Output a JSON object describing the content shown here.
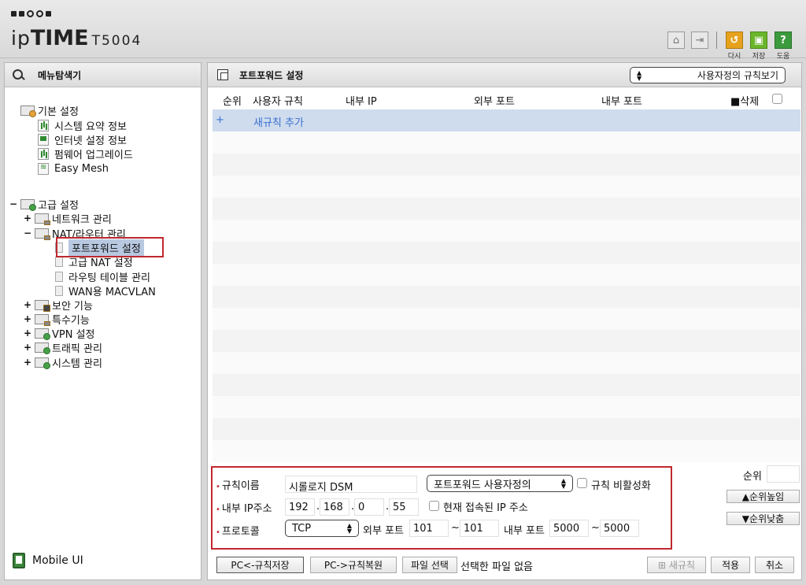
{
  "header": {
    "brand": "ipTIME",
    "brand_prefix": "ip",
    "brand_bold": "TIME",
    "model": "T5004",
    "buttons": [
      {
        "icon": "home-icon"
      },
      {
        "icon": "logout-icon"
      }
    ],
    "actions": [
      {
        "icon": "undo-icon",
        "label": "다시",
        "color": "#e6a21c"
      },
      {
        "icon": "save-icon",
        "label": "저장",
        "color": "#6ab52b"
      },
      {
        "icon": "help-icon",
        "label": "도움",
        "color": "#3b9a3b"
      }
    ]
  },
  "sidebar": {
    "title": "메뉴탐색기",
    "basic": {
      "label": "기본 설정",
      "items": [
        "시스템 요약 정보",
        "인터넷 설정 정보",
        "펌웨어 업그레이드",
        "Easy Mesh"
      ]
    },
    "advanced": {
      "label": "고급 설정",
      "groups": {
        "network": "네트워크 관리",
        "nat": "NAT/라우터 관리",
        "nat_items": [
          "포트포워드 설정",
          "고급 NAT 설정",
          "라우팅 테이블 관리",
          "WAN용 MACVLAN"
        ],
        "security": "보안 기능",
        "special": "특수기능",
        "vpn": "VPN 설정",
        "traffic": "트래픽 관리",
        "system": "시스템 관리"
      }
    },
    "mobile_ui": "Mobile UI"
  },
  "main": {
    "title": "포트포워드 설정",
    "view_select": "사용자정의 규칙보기",
    "columns": {
      "order": "순위",
      "rule": "사용자 규칙",
      "internal_ip": "내부 IP",
      "external_port": "외부 포트",
      "internal_port": "내부 포트",
      "delete": "삭제"
    },
    "add_rule": {
      "plus": "+",
      "label": "새규칙 추가"
    }
  },
  "form": {
    "rule_name_label": "규칙이름",
    "rule_name_value": "시롤로지 DSM",
    "type_select": "포트포워드 사용자정의",
    "disable_label": "규칙 비활성화",
    "ip_label": "내부 IP주소",
    "ip": [
      "192",
      "168",
      "0",
      "55"
    ],
    "current_ip_label": "현재 접속된 IP 주소",
    "protocol_label": "프로토콜",
    "protocol": "TCP",
    "ext_port_label": "외부 포트",
    "ext_port_from": "101",
    "ext_port_to": "101",
    "tilde": "~",
    "int_port_label": "내부 포트",
    "int_port_from": "5000",
    "int_port_to": "5000",
    "order_label": "순위",
    "order_up": "순위높임",
    "order_down": "순위낮춤"
  },
  "bottom": {
    "pc_save": "PC<-규칙저장",
    "pc_restore": "PC->규칙복원",
    "file_select": "파일 선택",
    "no_file": "선택한 파일 없음",
    "new_rule": "새규칙",
    "apply": "적용",
    "cancel": "취소"
  },
  "colors": {
    "highlight_box": "#c0282e",
    "add_row_bg": "#cfdcee",
    "add_row_text": "#3a6fd0",
    "selected_item_bg": "#b8c8e0"
  }
}
